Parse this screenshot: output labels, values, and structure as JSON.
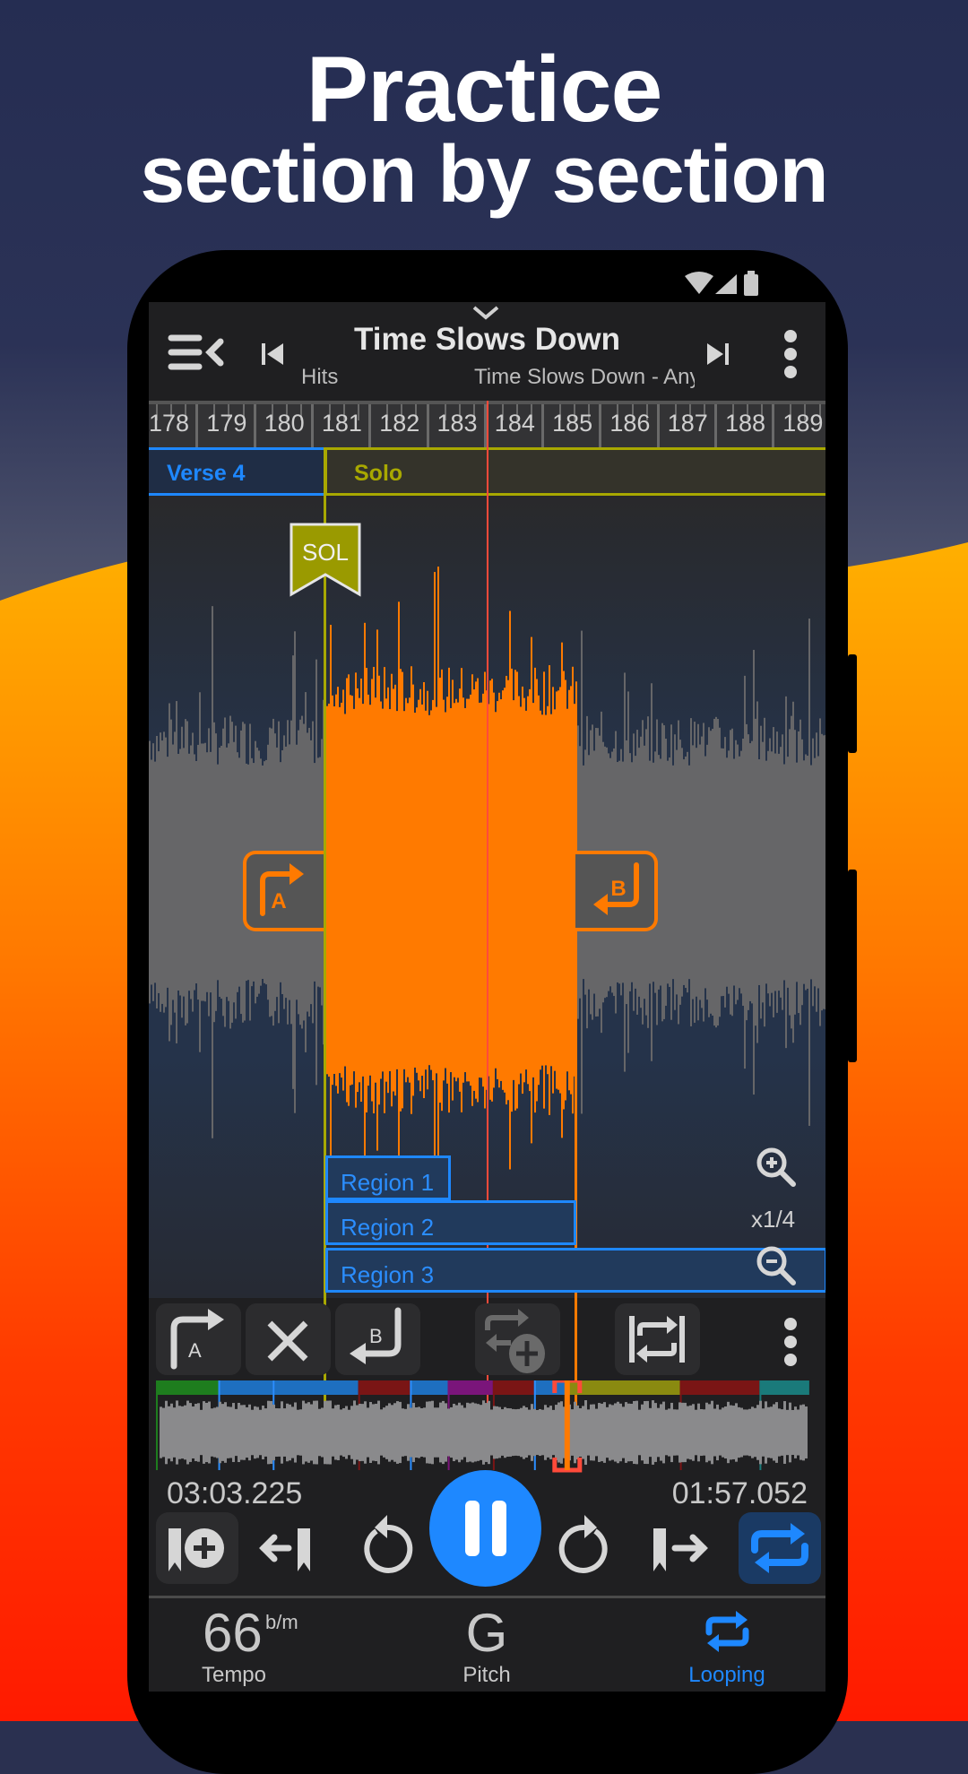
{
  "promo": {
    "headline_line1": "Practice",
    "headline_line2": "section by section"
  },
  "status_bar": {
    "icons": [
      "wifi-icon",
      "cellular-signal-icon",
      "battery-icon"
    ]
  },
  "header": {
    "title": "Time Slows Down",
    "subtitle_left": "Hits",
    "subtitle_right": "Time Slows Down - Any",
    "collapse_icon": "chevron-down-icon",
    "menu_icon": "playlist-back-icon",
    "prev_icon": "skip-previous-icon",
    "next_icon": "skip-next-icon",
    "more_icon": "more-vertical-icon"
  },
  "ruler": {
    "measures": [
      "178",
      "179",
      "180",
      "181",
      "182",
      "183",
      "184",
      "185",
      "186",
      "187",
      "188",
      "189"
    ]
  },
  "sections": [
    {
      "label": "Verse 4",
      "color": "#1e88ff"
    },
    {
      "label": "Solo",
      "color": "#a8a800"
    }
  ],
  "marker": {
    "label": "SOL",
    "color": "#9a9a00"
  },
  "loop_handles": {
    "a_label": "A",
    "b_label": "B",
    "color": "#ff7a00"
  },
  "regions": [
    {
      "label": "Region 1"
    },
    {
      "label": "Region 2"
    },
    {
      "label": "Region 3"
    }
  ],
  "zoom": {
    "level": "x1/4",
    "zoom_in_icon": "zoom-in-icon",
    "zoom_out_icon": "zoom-out-icon"
  },
  "loop_toolbar": {
    "set_a_icon": "set-loop-start-icon",
    "clear_icon": "clear-loop-icon",
    "set_b_icon": "set-loop-end-icon",
    "add_loop_icon": "add-loop-icon",
    "fit_loop_icon": "loop-to-markers-icon",
    "more_icon": "more-vertical-icon"
  },
  "overview": {
    "section_colors": [
      "#1e7d1e",
      "#1e6fc0",
      "#1e6fc0",
      "#7a1515",
      "#1e6fc0",
      "#7a157a",
      "#7a1515",
      "#1e6fc0",
      "#8a8a10",
      "#7a1515",
      "#1a7a7a"
    ],
    "playhead_position_fraction": 0.62
  },
  "transport": {
    "elapsed": "03:03.225",
    "remaining": "01:57.052",
    "add_marker_icon": "add-bookmark-icon",
    "prev_marker_icon": "previous-marker-icon",
    "rewind_icon": "replay-icon",
    "play_pause_icon": "pause-icon",
    "forward_icon": "forward-icon",
    "next_marker_icon": "next-marker-icon",
    "loop_toggle_icon": "repeat-icon",
    "loop_active": true,
    "accent_color": "#1e88ff"
  },
  "bottom_nav": {
    "tempo_value": "66",
    "tempo_unit": "b/m",
    "tempo_label": "Tempo",
    "pitch_value": "G",
    "pitch_label": "Pitch",
    "looping_label": "Looping",
    "active_tab": "Looping"
  }
}
